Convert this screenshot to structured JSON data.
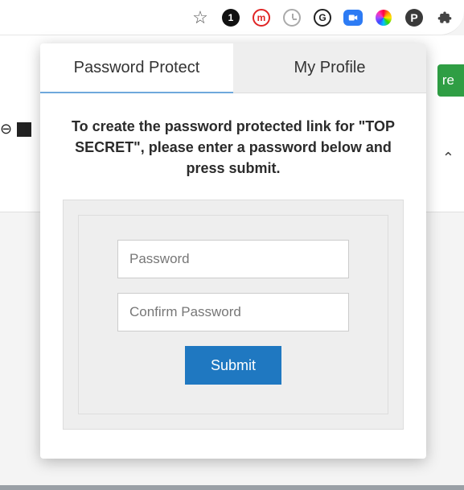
{
  "browser": {
    "icons": {
      "star": "☆",
      "one": "1",
      "m": "m",
      "g": "G",
      "p": "P"
    }
  },
  "page": {
    "share_partial": "re",
    "link_glyph": "⊖",
    "caret": "⌃"
  },
  "popup": {
    "tabs": {
      "password_protect": "Password Protect",
      "my_profile": "My Profile"
    },
    "instruction": "To create the password protected link for \"TOP SECRET\", please enter a password below and press submit.",
    "password_placeholder": "Password",
    "confirm_placeholder": "Confirm Password",
    "submit": "Submit"
  }
}
